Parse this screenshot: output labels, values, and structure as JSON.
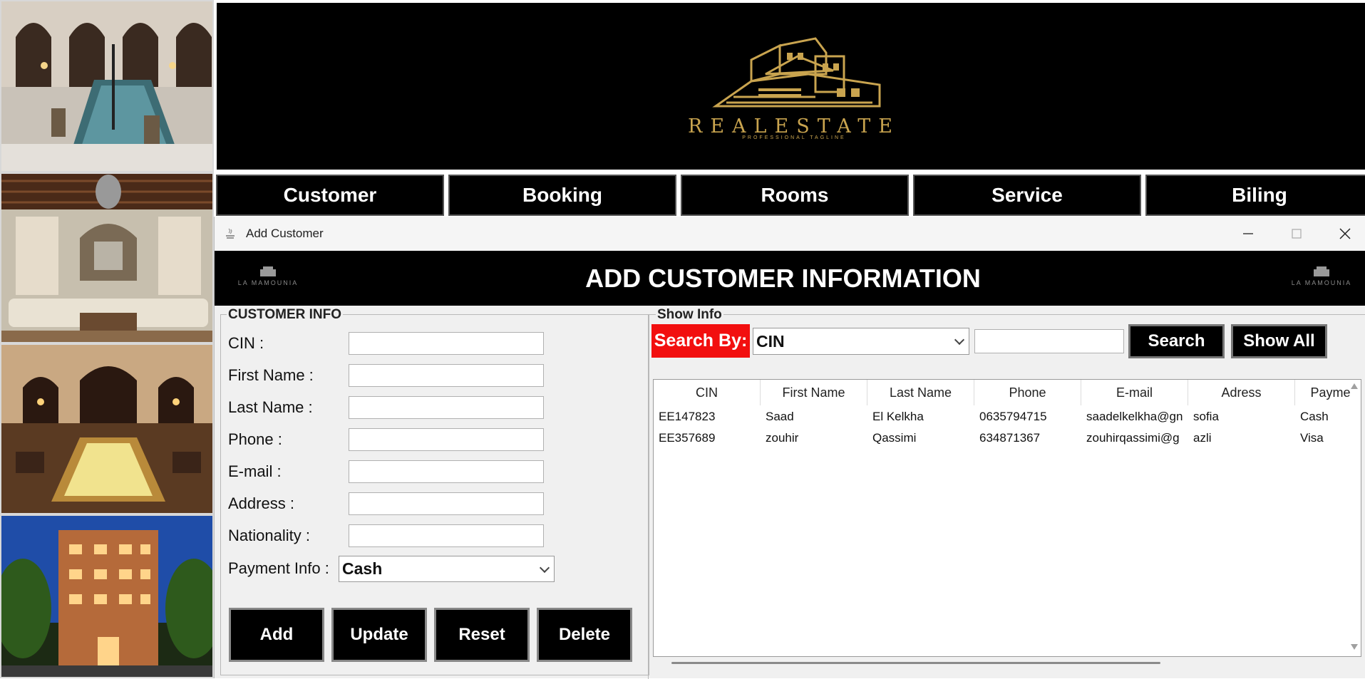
{
  "header": {
    "logo_text": "REALESTATE",
    "logo_tagline": "PROFESSIONAL TAGLINE"
  },
  "nav": {
    "items": [
      "Customer",
      "Booking",
      "Rooms",
      "Service",
      "Biling"
    ]
  },
  "dialog": {
    "title": "Add Customer",
    "banner_title": "ADD CUSTOMER INFORMATION",
    "mini_logo_text": "LA MAMOUNIA"
  },
  "customer_info": {
    "legend": "CUSTOMER INFO",
    "fields": [
      {
        "label": "CIN :",
        "value": ""
      },
      {
        "label": "First Name :",
        "value": ""
      },
      {
        "label": "Last Name :",
        "value": ""
      },
      {
        "label": "Phone :",
        "value": ""
      },
      {
        "label": "E-mail :",
        "value": ""
      },
      {
        "label": "Address :",
        "value": ""
      },
      {
        "label": "Nationality :",
        "value": ""
      }
    ],
    "payment_label": "Payment Info :",
    "payment_value": "Cash",
    "buttons": [
      "Add",
      "Update",
      "Reset",
      "Delete"
    ]
  },
  "show_info": {
    "legend": "Show Info",
    "search_by_label": "Search By:",
    "search_by_value": "CIN",
    "search_text": "",
    "search_button": "Search",
    "show_all_button": "Show All",
    "columns": [
      "CIN",
      "First Name",
      "Last Name",
      "Phone",
      "E-mail",
      "Adress",
      "Payme"
    ],
    "rows": [
      [
        "EE147823",
        "Saad",
        "El Kelkha",
        "0635794715",
        "saadelkelkha@gn",
        "sofia",
        "Cash"
      ],
      [
        "EE357689",
        "zouhir",
        "Qassimi",
        "634871367",
        "zouhirqassimi@g",
        "azli",
        "Visa"
      ]
    ]
  },
  "colors": {
    "accent_red": "#f20f0f",
    "logo_gold": "#c9a44f",
    "button_black": "#000000"
  }
}
